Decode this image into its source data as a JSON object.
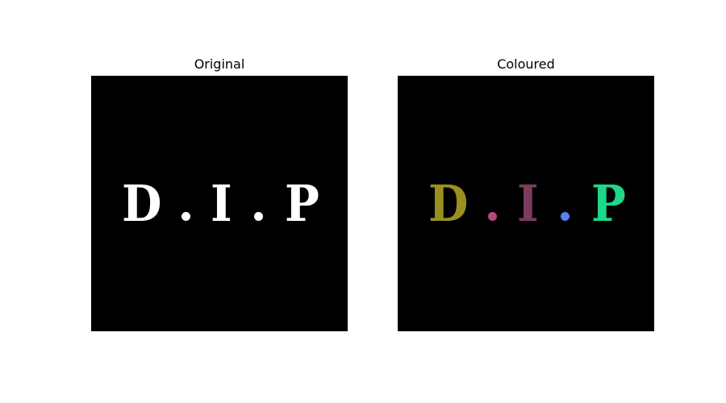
{
  "figure": {
    "panels": [
      {
        "title": "Original",
        "letters": [
          "D",
          "I",
          "P"
        ],
        "colors": {
          "D": "#ffffff",
          "dot1": "#ffffff",
          "I": "#ffffff",
          "dot2": "#ffffff",
          "P": "#ffffff"
        }
      },
      {
        "title": "Coloured",
        "letters": [
          "D",
          "I",
          "P"
        ],
        "colors": {
          "D": "#9a9020",
          "dot1": "#b04a7c",
          "I": "#7c3b5e",
          "dot2": "#5a7ff0",
          "P": "#20d68a"
        }
      }
    ]
  }
}
